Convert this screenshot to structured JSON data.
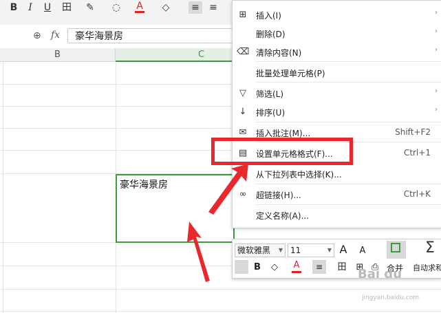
{
  "toolbar": {
    "bold": "B",
    "italic": "I",
    "underline": "U",
    "border": "田",
    "font_color": "A",
    "align_left": "≡",
    "align_center": "≡"
  },
  "formula_bar": {
    "fx_label": "fx",
    "value": "豪华海景房"
  },
  "columns": [
    "B",
    "C"
  ],
  "cell": {
    "value": "豪华海景房"
  },
  "context_menu": {
    "items": [
      {
        "label": "插入(I)",
        "shortcut": "",
        "has_submenu": true,
        "icon": "insert-icon"
      },
      {
        "label": "删除(D)",
        "shortcut": "",
        "has_submenu": true,
        "icon": ""
      },
      {
        "label": "清除内容(N)",
        "shortcut": "",
        "has_submenu": true,
        "icon": "eraser-icon"
      },
      {
        "label": "批量处理单元格(P)",
        "shortcut": "",
        "has_submenu": false,
        "icon": ""
      },
      {
        "label": "筛选(L)",
        "shortcut": "",
        "has_submenu": true,
        "icon": "filter-icon"
      },
      {
        "label": "排序(U)",
        "shortcut": "",
        "has_submenu": true,
        "icon": "sort-icon"
      },
      {
        "label": "插入批注(M)...",
        "shortcut": "Shift+F2",
        "has_submenu": false,
        "icon": "comment-icon"
      },
      {
        "label": "设置单元格格式(F)...",
        "shortcut": "Ctrl+1",
        "has_submenu": false,
        "icon": "format-cells-icon"
      },
      {
        "label": "从下拉列表中选择(K)...",
        "shortcut": "",
        "has_submenu": false,
        "icon": ""
      },
      {
        "label": "超链接(H)...",
        "shortcut": "Ctrl+K",
        "has_submenu": false,
        "icon": "link-icon"
      },
      {
        "label": "定义名称(A)...",
        "shortcut": "",
        "has_submenu": false,
        "icon": ""
      }
    ]
  },
  "mini_toolbar": {
    "font_name": "微软雅黑",
    "font_size": "11",
    "grow_font": "A",
    "shrink_font": "A",
    "merge_label": "合并",
    "autosum_label": "自动求和",
    "bold": "B",
    "font_color": "A"
  },
  "watermark": {
    "brand": "Bai du",
    "sub": "jingyan.baidu.com"
  },
  "colors": {
    "selection_border": "#3a9b3a",
    "annotation_red": "#e8282c"
  }
}
